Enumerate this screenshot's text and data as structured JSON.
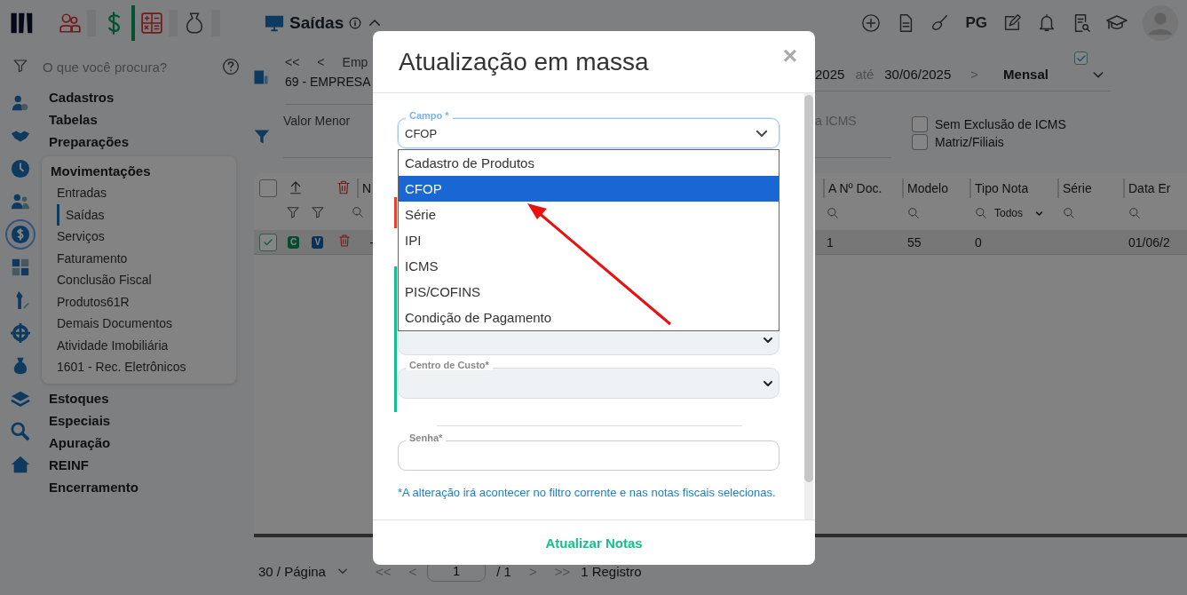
{
  "top_bar": {
    "title": "Saídas",
    "right_text": "PG"
  },
  "rail": [
    {
      "selected": false
    },
    {
      "selected": false
    },
    {
      "selected": false
    },
    {
      "selected": false
    },
    {
      "selected": true
    },
    {
      "selected": false
    },
    {
      "selected": false
    },
    {
      "selected": false
    },
    {
      "selected": false
    },
    {
      "selected": false
    },
    {
      "selected": false
    },
    {
      "selected": false
    }
  ],
  "sidebar": {
    "search_placeholder": "O que você procura?",
    "menu": [
      {
        "label": "Cadastros",
        "expanded": false
      },
      {
        "label": "Tabelas",
        "expanded": false
      },
      {
        "label": "Preparações",
        "expanded": false
      },
      {
        "label": "Movimentações",
        "expanded": true,
        "children": [
          {
            "label": "Entradas",
            "selected": false
          },
          {
            "label": "Saídas",
            "selected": true
          },
          {
            "label": "Serviços",
            "selected": false
          },
          {
            "label": "Faturamento",
            "selected": false
          },
          {
            "label": "Conclusão Fiscal",
            "selected": false
          },
          {
            "label": "Produtos61R",
            "selected": false
          },
          {
            "label": "Demais Documentos",
            "selected": false
          },
          {
            "label": "Atividade Imobiliária",
            "selected": false
          },
          {
            "label": "1601 - Rec. Eletrônicos",
            "selected": false
          }
        ]
      },
      {
        "label": "Estoques",
        "expanded": false
      },
      {
        "label": "Especiais",
        "expanded": false
      },
      {
        "label": "Apuração",
        "expanded": false
      },
      {
        "label": "REINF",
        "expanded": false
      },
      {
        "label": "Encerramento",
        "expanded": false
      }
    ]
  },
  "company": {
    "first": "<<",
    "prev": "<",
    "label": "Emp",
    "name": "69 - EMPRESA"
  },
  "period": {
    "checked": true,
    "from": "2025",
    "separator": "até",
    "to": "30/06/2025",
    "next": ">",
    "mode": "Mensal"
  },
  "filters": {
    "left_field": "Valor Menor",
    "right_field": "a ICMS",
    "checks": [
      {
        "label": "Sem Exclusão de ICMS",
        "checked": false
      },
      {
        "label": "Matriz/Filiais",
        "checked": false
      }
    ]
  },
  "table": {
    "select_all": {
      "checked": false
    },
    "left_column": "N",
    "columns": [
      "A Nº Doc.",
      "Modelo",
      "Tipo Nota",
      "Série",
      "Data Er"
    ],
    "type_filter": "Todos",
    "rows": [
      {
        "checked": true,
        "badges": [
          "C",
          "V"
        ],
        "left_cell": "-",
        "cells": [
          "1",
          "55",
          "0",
          "",
          "01/06/2"
        ]
      }
    ]
  },
  "pagination": {
    "page_size": "30 / Página",
    "first": "<<",
    "prev": "<",
    "page": "1",
    "total": "/ 1",
    "next": ">",
    "last": ">>",
    "count": "1 Registro"
  },
  "modal": {
    "title": "Atualização em massa",
    "close": "×",
    "field": {
      "label": "Campo *",
      "value": "CFOP",
      "expanded": true,
      "options": [
        {
          "label": "Cadastro de Produtos",
          "selected": false
        },
        {
          "label": "CFOP",
          "selected": true
        },
        {
          "label": "Série",
          "selected": false
        },
        {
          "label": "IPI",
          "selected": false
        },
        {
          "label": "ICMS",
          "selected": false
        },
        {
          "label": "PIS/COFINS",
          "selected": false
        },
        {
          "label": "Condição de Pagamento",
          "selected": false
        }
      ]
    },
    "sections": [
      {
        "color": "#e8412c"
      },
      {
        "color": "#14c08c"
      }
    ],
    "cost_center": {
      "label": "Centro de Custo*"
    },
    "password": {
      "label": "Senha*"
    },
    "note": "*A alteração irá acontecer no filtro corrente e nas notas fiscais selecionas.",
    "submit": "Atualizar Notas"
  }
}
